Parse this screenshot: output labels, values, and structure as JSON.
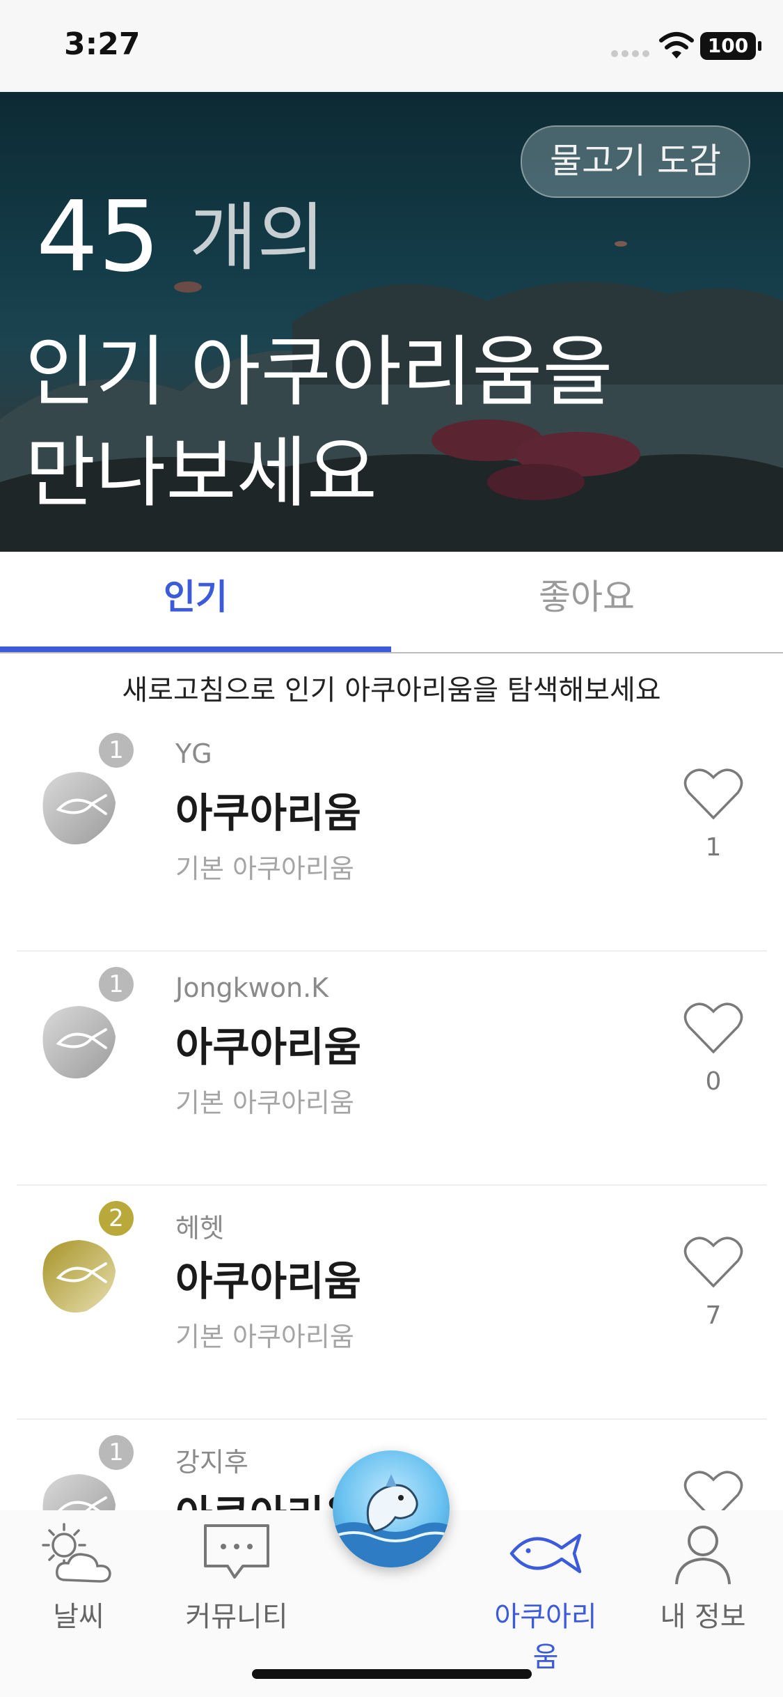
{
  "status_bar": {
    "time": "3:27",
    "battery": "100"
  },
  "hero": {
    "fish_guide_button": "물고기 도감",
    "count": "45",
    "count_unit": "개의",
    "title_line1": "인기 아쿠아리움을",
    "title_line2": "만나보세요"
  },
  "tabs": {
    "popular": "인기",
    "liked": "좋아요",
    "active": "popular"
  },
  "refresh_hint": "새로고침으로 인기 아쿠아리움을 탐색해보세요",
  "aquariums": [
    {
      "rank": "1",
      "owner": "YG",
      "name": "아쿠아리움",
      "type": "기본 아쿠아리움",
      "likes": "1",
      "badge_color": "#b9b9b9"
    },
    {
      "rank": "1",
      "owner": "Jongkwon.K",
      "name": "아쿠아리움",
      "type": "기본 아쿠아리움",
      "likes": "0",
      "badge_color": "#b9b9b9"
    },
    {
      "rank": "2",
      "owner": "헤헷",
      "name": "아쿠아리움",
      "type": "기본 아쿠아리움",
      "likes": "7",
      "badge_color": "#b8a93a"
    },
    {
      "rank": "1",
      "owner": "강지후",
      "name": "아쿠아리움",
      "type": "",
      "likes": "",
      "badge_color": "#b9b9b9"
    }
  ],
  "bottom_nav": {
    "weather": "날씨",
    "community": "커뮤니티",
    "aquarium": "아쿠아리움",
    "my_info": "내 정보",
    "active": "aquarium"
  },
  "colors": {
    "accent": "#3b5bdb",
    "gold_badge": "#b8a93a",
    "silver_badge": "#b9b9b9"
  }
}
